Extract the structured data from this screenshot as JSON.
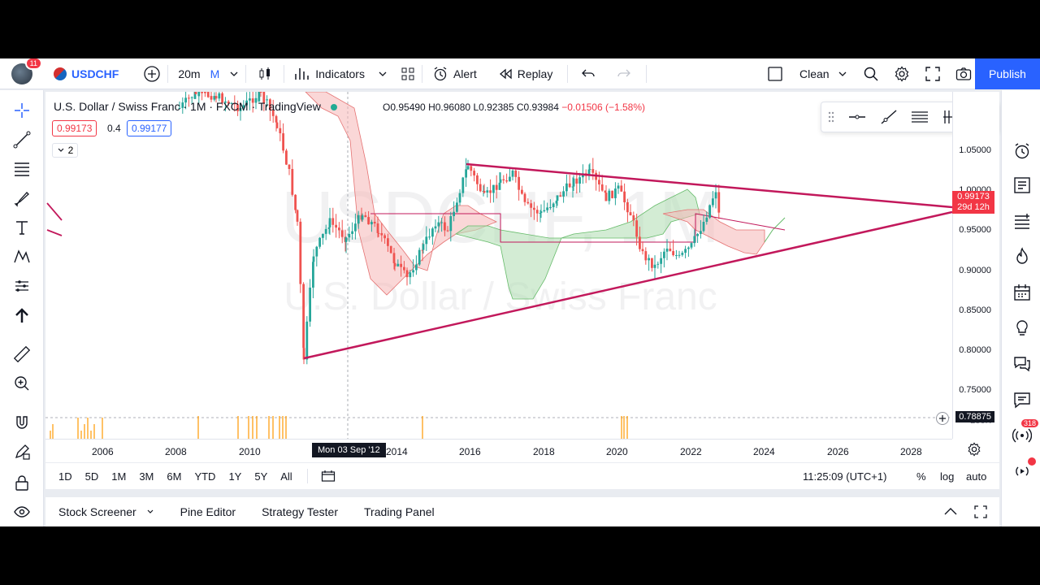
{
  "header": {
    "notification_count": "11",
    "symbol": "USDCHF",
    "interval": "20m",
    "interval_unit": "M",
    "indicators_label": "Indicators",
    "alert_label": "Alert",
    "replay_label": "Replay",
    "layout_name": "Clean",
    "publish_label": "Publish"
  },
  "legend": {
    "title": "U.S. Dollar / Swiss Franc · 1M · FXCM · TradingView",
    "open": "O0.95490",
    "high": "H0.96080",
    "low": "L0.92385",
    "close": "C0.93984",
    "change": "−0.01506 (−1.58%)",
    "bid": "0.99173",
    "spread": "0.4",
    "ask": "0.99177",
    "collapsed_count": "2"
  },
  "watermark": {
    "symbol": "USDCHF, 1M",
    "description": "U.S. Dollar / Swiss Franc"
  },
  "price_axis": {
    "ticks": [
      "1.05000",
      "1.00000",
      "0.95000",
      "0.90000",
      "0.85000",
      "0.80000",
      "0.75000"
    ],
    "volume_tick": "250K",
    "current_price": "0.99173",
    "countdown": "29d 12h",
    "crosshair_price": "0.78875"
  },
  "time_axis": {
    "ticks": [
      "2006",
      "2008",
      "2010",
      "2014",
      "2016",
      "2018",
      "2020",
      "2022",
      "2024",
      "2026",
      "2028"
    ],
    "crosshair_date": "Mon 03 Sep '12"
  },
  "range_bar": {
    "ranges": [
      "1D",
      "5D",
      "1M",
      "3M",
      "6M",
      "YTD",
      "1Y",
      "5Y",
      "All"
    ],
    "clock": "11:25:09 (UTC+1)",
    "percent_label": "%",
    "log_label": "log",
    "auto_label": "auto"
  },
  "bottom_panel": {
    "tabs": [
      "Stock Screener",
      "Pine Editor",
      "Strategy Tester",
      "Trading Panel"
    ]
  },
  "right_toolbar": {
    "notification_count": "318"
  },
  "colors": {
    "accent": "#2962ff",
    "trendline": "#c2185b",
    "cloud_bull": "#a5d6a7",
    "cloud_bear": "#ef9a9a",
    "up": "#22ab94",
    "down": "#f23645"
  }
}
